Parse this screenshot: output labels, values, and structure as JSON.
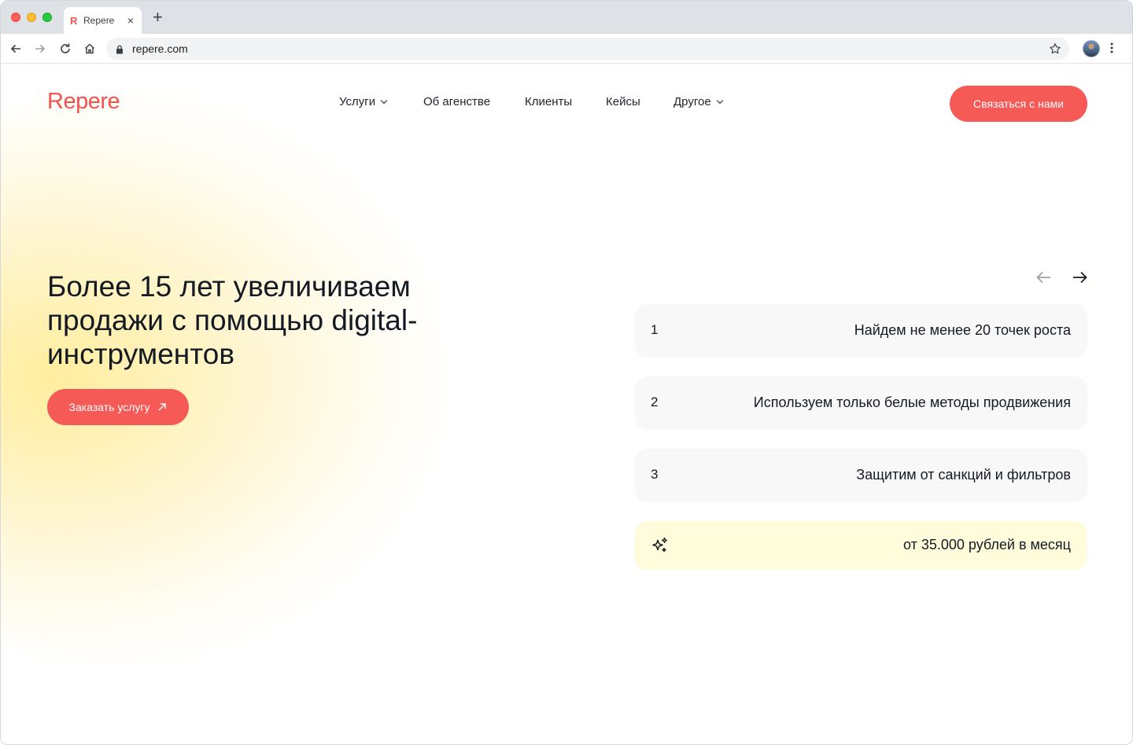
{
  "browser": {
    "tab": {
      "favicon_letter": "R",
      "title": "Repere",
      "close_glyph": "×"
    },
    "new_tab_glyph": "+",
    "address_bar": {
      "url": "repere.com"
    }
  },
  "site": {
    "logo": "Repere",
    "nav": [
      {
        "label": "Услуги",
        "has_dropdown": true
      },
      {
        "label": "Об агенстве",
        "has_dropdown": false
      },
      {
        "label": "Клиенты",
        "has_dropdown": false
      },
      {
        "label": "Кейсы",
        "has_dropdown": false
      },
      {
        "label": "Другое",
        "has_dropdown": true
      }
    ],
    "contact_button": "Связаться с нами",
    "accent_color": "#f65a57"
  },
  "hero": {
    "title_lines": [
      "Более 15 лет увеличиваем",
      "продажи с помощью digital-",
      "инструментов"
    ],
    "order_button": "Заказать услугу"
  },
  "slider": {
    "items": [
      {
        "number": "1",
        "text": "Найдем не менее 20 точек роста"
      },
      {
        "number": "2",
        "text": "Используем только белые методы продвижения"
      },
      {
        "number": "3",
        "text": "Защитим от санкций и фильтров"
      }
    ],
    "price": {
      "icon": "sparkles-icon",
      "text": "от 35.000 рублей в месяц"
    }
  }
}
